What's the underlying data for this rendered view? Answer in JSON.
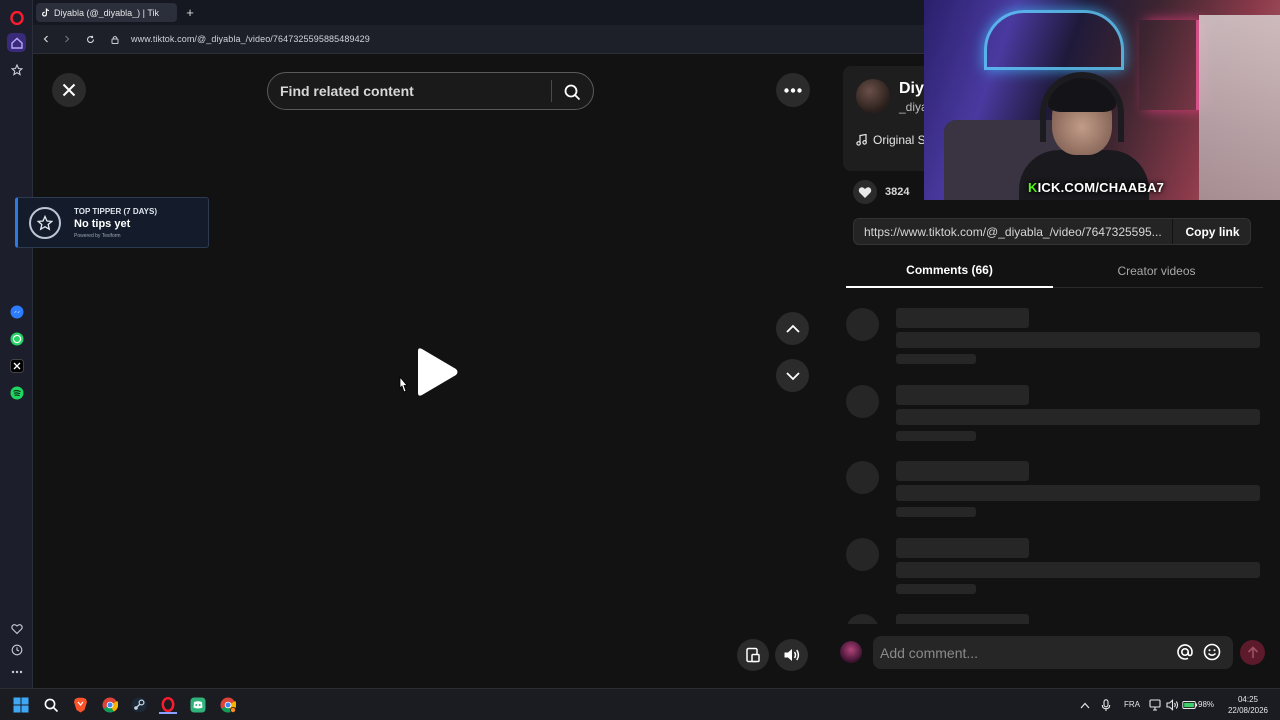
{
  "browser": {
    "tab_title": "Diyabla (@_diyabla_) | Tik",
    "url": "www.tiktok.com/@_diyabla_/video/7647325595885489429"
  },
  "video": {
    "search_placeholder": "Find related content"
  },
  "tipper": {
    "title": "TOP TIPPER (7 DAYS)",
    "main": "No tips yet",
    "sub": "Powered by Tesiform"
  },
  "author": {
    "name": "Diy",
    "handle": "_diya",
    "music": "Original S",
    "likes": "3824"
  },
  "share": {
    "link": "https://www.tiktok.com/@_diyabla_/video/7647325595...",
    "copy_label": "Copy link"
  },
  "tabs": {
    "comments": "Comments (66)",
    "creator": "Creator videos"
  },
  "comment_bar": {
    "placeholder": "Add comment..."
  },
  "webcam": {
    "kick_first": "K",
    "kick_rest": "ICK.COM/CHAABA7"
  },
  "taskbar": {
    "lang": "FRA",
    "battery": "98%",
    "time": "04:25",
    "date": "22/08/2026"
  },
  "colors": {
    "accent_send": "#5c1a2a",
    "kick_green": "#53fc18",
    "tipper_blue": "#2c7be5"
  }
}
